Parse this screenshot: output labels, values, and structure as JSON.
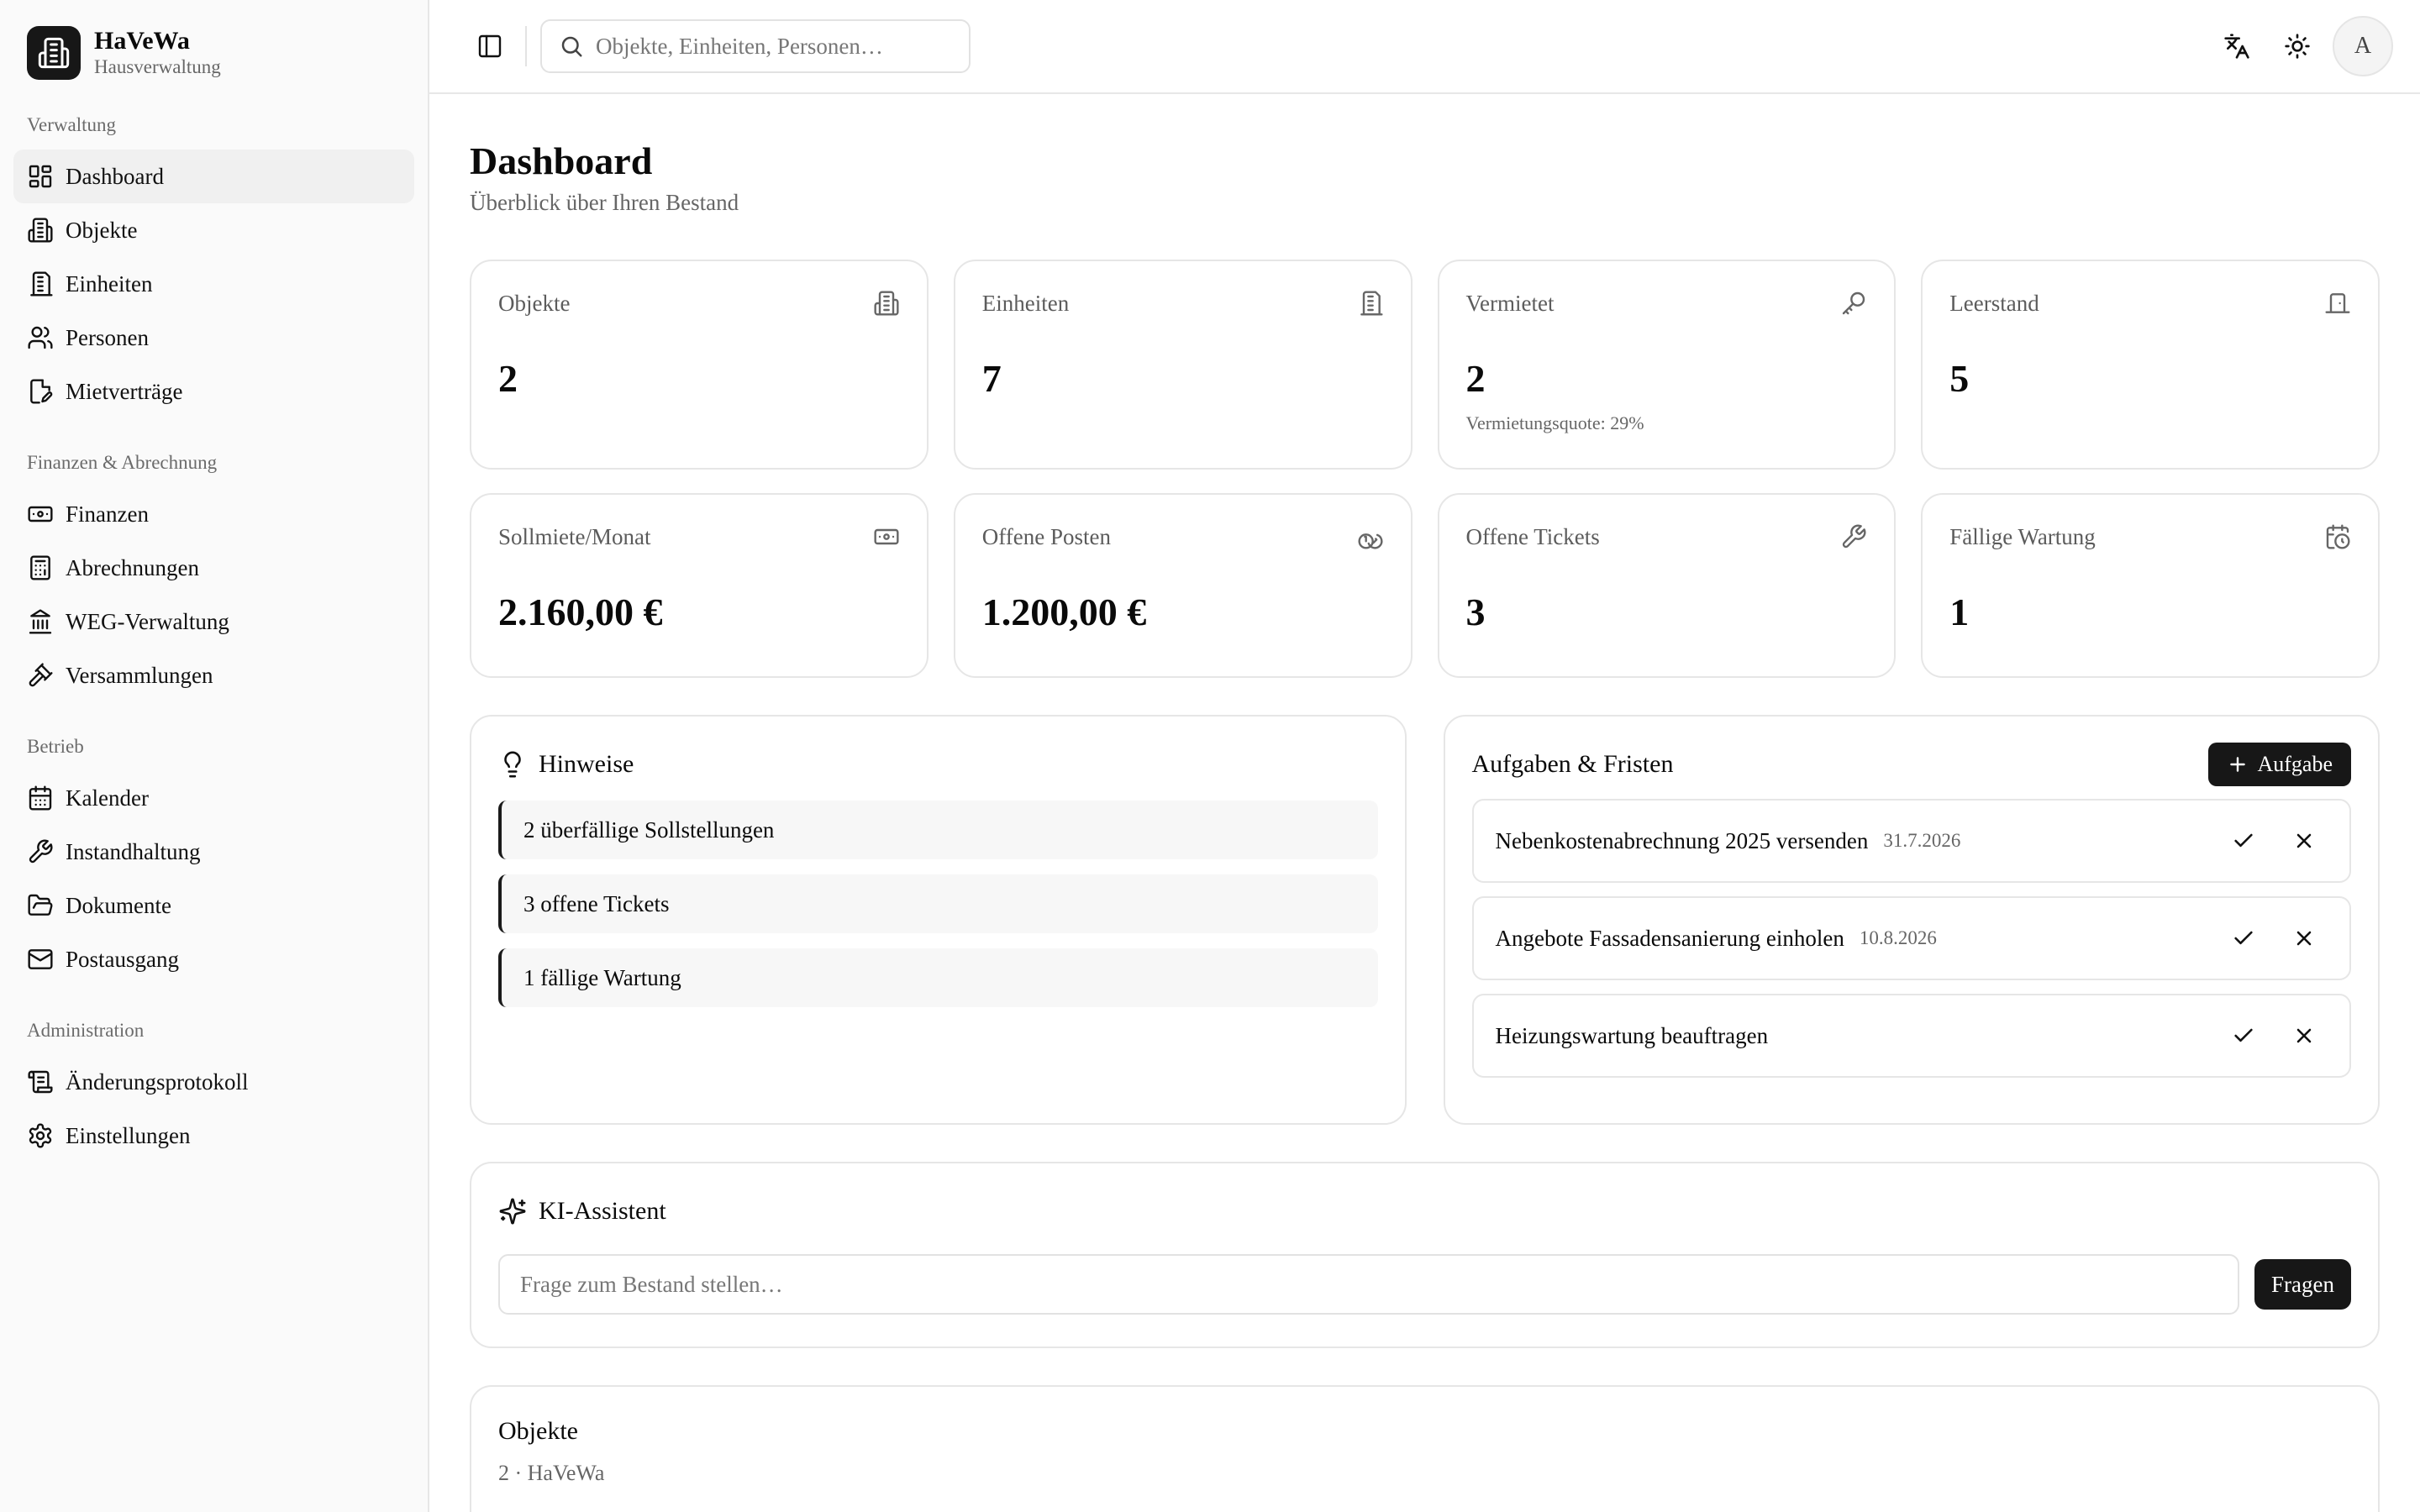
{
  "brand": {
    "name": "HaVeWa",
    "subtitle": "Hausverwaltung"
  },
  "sidebar": {
    "groups": [
      {
        "label": "Verwaltung",
        "items": [
          {
            "label": "Dashboard",
            "icon": "dashboard-icon",
            "active": true
          },
          {
            "label": "Objekte",
            "icon": "building-icon"
          },
          {
            "label": "Einheiten",
            "icon": "units-icon"
          },
          {
            "label": "Personen",
            "icon": "users-icon"
          },
          {
            "label": "Mietverträge",
            "icon": "contract-icon"
          }
        ]
      },
      {
        "label": "Finanzen & Abrechnung",
        "items": [
          {
            "label": "Finanzen",
            "icon": "banknote-icon"
          },
          {
            "label": "Abrechnungen",
            "icon": "calculator-icon"
          },
          {
            "label": "WEG-Verwaltung",
            "icon": "landmark-icon"
          },
          {
            "label": "Versammlungen",
            "icon": "gavel-icon"
          }
        ]
      },
      {
        "label": "Betrieb",
        "items": [
          {
            "label": "Kalender",
            "icon": "calendar-icon"
          },
          {
            "label": "Instandhaltung",
            "icon": "wrench-icon"
          },
          {
            "label": "Dokumente",
            "icon": "folder-icon"
          },
          {
            "label": "Postausgang",
            "icon": "mail-icon"
          }
        ]
      },
      {
        "label": "Administration",
        "items": [
          {
            "label": "Änderungsprotokoll",
            "icon": "scroll-icon"
          },
          {
            "label": "Einstellungen",
            "icon": "gear-icon"
          }
        ]
      }
    ]
  },
  "topbar": {
    "search_placeholder": "Objekte, Einheiten, Personen…",
    "avatar_initial": "A"
  },
  "page": {
    "title": "Dashboard",
    "subtitle": "Überblick über Ihren Bestand"
  },
  "stats": [
    {
      "label": "Objekte",
      "value": "2",
      "icon": "building-icon"
    },
    {
      "label": "Einheiten",
      "value": "7",
      "icon": "units-icon"
    },
    {
      "label": "Vermietet",
      "value": "2",
      "note": "Vermietungsquote: 29%",
      "icon": "key-icon"
    },
    {
      "label": "Leerstand",
      "value": "5",
      "icon": "door-icon"
    },
    {
      "label": "Sollmiete/Monat",
      "value": "2.160,00 €",
      "icon": "banknote-icon"
    },
    {
      "label": "Offene Posten",
      "value": "1.200,00 €",
      "icon": "coins-icon"
    },
    {
      "label": "Offene Tickets",
      "value": "3",
      "icon": "wrench-icon"
    },
    {
      "label": "Fällige Wartung",
      "value": "1",
      "icon": "calendar-clock-icon"
    }
  ],
  "hints": {
    "title": "Hinweise",
    "items": [
      "2 überfällige Sollstellungen",
      "3 offene Tickets",
      "1 fällige Wartung"
    ]
  },
  "tasks": {
    "title": "Aufgaben & Fristen",
    "add_label": "Aufgabe",
    "items": [
      {
        "title": "Nebenkostenabrechnung 2025 versenden",
        "date": "31.7.2026"
      },
      {
        "title": "Angebote Fassadensanierung einholen",
        "date": "10.8.2026"
      },
      {
        "title": "Heizungswartung beauftragen",
        "date": ""
      }
    ]
  },
  "assistant": {
    "title": "KI-Assistent",
    "placeholder": "Frage zum Bestand stellen…",
    "ask_label": "Fragen"
  },
  "objects": {
    "title": "Objekte",
    "subtitle": "2 · HaVeWa"
  }
}
